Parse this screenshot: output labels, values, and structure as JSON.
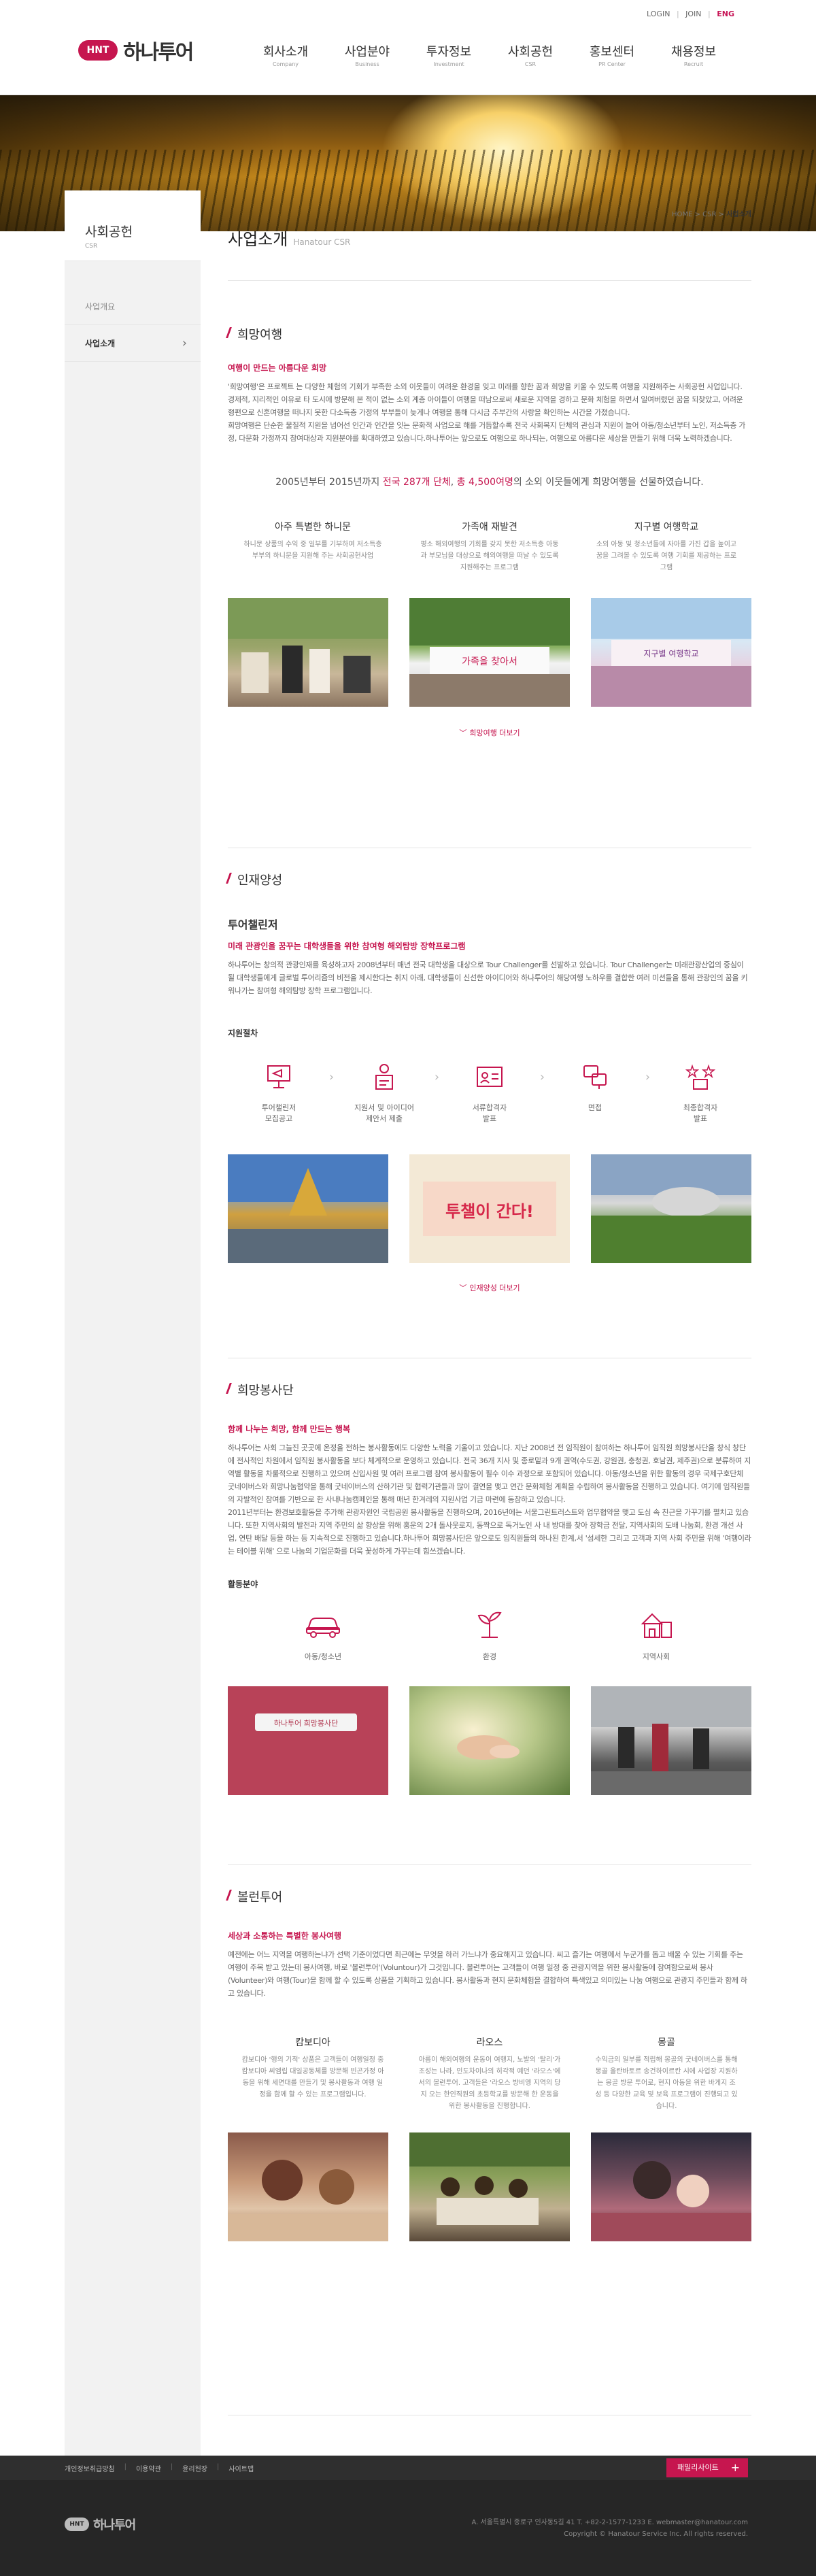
{
  "util": {
    "login": "LOGIN",
    "join": "JOIN",
    "lang_ko": "|",
    "lang_en": "ENG"
  },
  "brand": {
    "mark": "HNT",
    "name": "하나투어"
  },
  "gnb": [
    {
      "ko": "회사소개",
      "en": "Company"
    },
    {
      "ko": "사업분야",
      "en": "Business"
    },
    {
      "ko": "투자정보",
      "en": "Investment"
    },
    {
      "ko": "사회공헌",
      "en": "CSR"
    },
    {
      "ko": "홍보센터",
      "en": "PR Center"
    },
    {
      "ko": "채용정보",
      "en": "Recruit"
    }
  ],
  "sidebar": {
    "title": "사회공헌",
    "subtitle": "CSR",
    "items": [
      {
        "label": "사업개요"
      },
      {
        "label": "사업소개"
      }
    ]
  },
  "breadcrumb": {
    "home": "HOME",
    "sep": ">",
    "csr": "CSR",
    "current": "사업소개"
  },
  "page": {
    "title": "사업소개",
    "subtitle": "Hanatour CSR"
  },
  "hope_travel": {
    "title": "희망여행",
    "lead": "여행이 만드는 아름다운 희망",
    "para1": "'희망여행'은 프로젝트 는 다양한 체험의 기회가 부족한 소외 이웃들이 여려운 환경을 잊고 미래를 향한 꿈과 희망을 키울 수 있도록 여행을 지원해주는 사회공헌 사업입니다.",
    "para2": "경제적, 지리적인 이유로 타 도시에 방문해 본 적이 없는 소외 계층 아이들이 여행을 떠남으로써 새로운 지역을 경하고 문화 체험을 하면서 일여버렸던 꿈을 되찾았고, 어려운 형편으로 신혼여행을 떠나지 못한 다소득층 가정의 부부들이 늦게나 여행을 통해 다시금 추부간의 사랑을 확인하는 시간을 가졌습니다.",
    "para3": "희망여행은 단순한 물질적 지원을 넘어선 인간과 인간을 잇는 문화적 사업으로 해를 거듭할수록 전국 사회복지 단체의 관심과 지원이 늘어 아동/청소년부터 노인, 저소득층 가정, 다문화 가정까지 참여대상과 지원분야를 확대하였고 있습니다.하나투어는 앞으로도 여행으로 하나되는, 여행으로 아름다운 세상을 만들기 위해 더욱 노력하겠습니다.",
    "stat_pre": "2005년부터 2015년까지",
    "stat_hl1": "전국 287개 단체",
    "stat_mid": ",",
    "stat_hl2": "총 4,500여명",
    "stat_post": "의 소외 이웃들에게 희망여행을 선물하였습니다.",
    "columns": [
      {
        "title": "아주 특별한 하니문",
        "desc": "하니문 상품의 수익 중 일부를 기부하여 저소득층 부부의 하니문을 지원해 주는 사회공헌사업"
      },
      {
        "title": "가족애 재발견",
        "desc": "평소 해외여행의 기회를 갖지 못한 저소득층 아동과 부모님을 대상으로 해외여행을 떠날 수 있도록 지원해주는 프로그램"
      },
      {
        "title": "지구별 여행학교",
        "desc": "소외 아동 및 청소년들에 자아를 가진 갑을 높이고 꿈을 그려볼 수 있도록 여행 기회를 제공하는 프로그램"
      }
    ],
    "photo_text": [
      "가족을 찾아서",
      "지구별 여행학교"
    ],
    "more": "희망여행 더보기"
  },
  "talent": {
    "title": "인재양성",
    "sub": "투어챌린저",
    "lead": "미래 관광인을 꿈꾸는 대학생들을 위한 참여형 해외탐방 장학프로그램",
    "para": "하나투어는 창의적 관광인재를 육성하고자 2008년부터 매년 전국 대학생을 대상으로 Tour Challenger를 선발하고 있습니다. Tour Challenger는 미래관광산업의 중심이 될 대학생들에게 글로벌 투어리즘의 비전을 제시한다는 취지 아래, 대학생들이 신선한 아이디어와 하나투어의 해당여행 노하우를 결합한 여러 미션들을 통해 관광인의 꿈을 키워나가는 참여형 해외탐방 장학 프로그램입니다.",
    "process_title": "지원절차",
    "steps": [
      {
        "label": "투어챌린저\n모집공고"
      },
      {
        "label": "지원서 및 아이디어\n제안서 제출"
      },
      {
        "label": "서류합격자\n발표"
      },
      {
        "label": "면접"
      },
      {
        "label": "최종합격자\n발표"
      }
    ],
    "arrow": "›",
    "photo_text": "투챌이 간다!",
    "more": "인재양성 더보기"
  },
  "volunteer": {
    "title": "희망봉사단",
    "lead": "함께 나누는 희망, 함께 만드는 행복",
    "para1": "하나투어는 사회 그늘진 곳곳에 온정을 전하는 봉사활동에도 다양한 노력을 기울이고 있습니다. 지난 2008년 전 임직원이 참여하는 하나투어 임직원 희망봉사단을 창식 창단에 전사적인 차원에서 임직원 봉사활동을 보다 체계적으로 운영하고 있습니다. 전국 36개 지사 및 종로밑과 9개 권역(수도권, 강원권, 충청권, 호남권, 제주권)으로 분류하여 지역별 활동을 차룰적으로 진행하고 있으며 신입사원 및 여러 프로그램 참여 봉사활동이 필수 이수 과정으로 포함되어 있습니다. 아동/청소년을 위한 활동의 경우 국제구호단체 굿네이버스와 희망나눔협약을 통해 굿네이버스의 산하기관 및 협력기관들과 많이 결연을 맺고 연간 문화체험 계획을 수립하여 봉사활동을 진행하고 있습니다. 여기에 임직원들의 자발적인 참여를 기반으로 한 사내나눔캠페인을 통해 매년 한겨레의 지원사업 기금 마련에 동참하고 있습니다.",
    "para2": "2011년부터는 환경보호활동을 추가해 관광자원인 국립공원 봉사활동을 진행하으며, 2016년에는 서울그린트러스트와 업무협약을 맺고 도심 속 친근을 가꾸기를 펼치고 있습니다. 또한 지역사회의 발전과 지역 주민의 삶 향상을 위해 홍운의 2개 돌사웃로지, 동짝으로 독거노인 사 내 방대를 찾아 장학금 전달, 지역사회의 도배 나눔회, 환경 개선 사업, 연탄 배달 등을 하는 등 지속적으로 진행하고 있습니다.하나투어 희망봉사단은 앞으로도 임직원들의 하나된 한계,서 '섬세한 그리고 고객과 지역 사회 주민을 위해 '여행이라는 테이블 위해' 으로 나눔의 기업문화를 더욱 꽃성하게 가꾸는데 힘쓰겠습니다.",
    "area_title": "활동분야",
    "areas": [
      {
        "label": "아동/청소년"
      },
      {
        "label": "환경"
      },
      {
        "label": "지역사회"
      }
    ],
    "photo_text": "하나투어 희망봉사단"
  },
  "voluntour": {
    "title": "볼런투어",
    "lead": "세상과 소통하는 특별한 봉사여행",
    "para": "예전에는 어느 지역을 여행하는냐가 선택 기준이었다면 최근에는 무엇을 하러 가느냐가 중요해지고 있습니다. 씨고 즐기는 여행에서 누군가를 돕고 배울 수 있는 기회를 주는 여행이 주목 받고 있는데 봉사여행, 바로 '볼런투어'(Voluntour)가 그것입니다. 볼런투어는 고객들이 여행 일정 중 관광지역을 위한 봉사활동에 참여함으로써 봉사(Volunteer)와 여행(Tour)을 함께 할 수 있도록 상품을 기획하고 있습니다. 봉사활동과 현지 문화체험을 결합하여 특색있고 의미있는 나눔 여행으로 관광지 주민들과 함께 하고 있습니다.",
    "columns": [
      {
        "title": "캄보디아",
        "desc": "캄보디아 '행의 기적' 상품은 고객들이 여행일정 중 캄보디아 씨엠립 대일공동체를 방문해 빈곤가정 아동을 위해 세면대를 만들기 및 봉사활동과 여행 일정을 함께 할 수 있는 프로그램입니다."
      },
      {
        "title": "라오스",
        "desc": "아름이 해외여행의 운동이 여행지, 노발의 '탈리'가 조성는 나라, 인도차이나의 히각적 예던 '라오스'에서의 볼런투어. 고객들은 '라오스 방비엥 지역의 당지 오는 한인직원의 초등학교를 방문해 한 운동을 위한 봉사활동을 진행합니다."
      },
      {
        "title": "몽골",
        "desc": "수익금의 일부를 적립해 몽골의 굿네이버스를 통해 몽골 울란바토르 송건하이르칸 시에 사업장 지원하는 몽골 방문 투어로, 현지 아동을 위한 바게지 조성 등 다양한 교육 및 보육 프로그램이 진행되고 있습니다."
      }
    ]
  },
  "footer": {
    "links": [
      "개인정보취급방침",
      "이용약관",
      "윤리헌장",
      "사이트맵"
    ],
    "sep": "|",
    "familysite": "패밀리사이트",
    "plus": "+",
    "logo_mark": "HNT",
    "logo_name": "하나투어",
    "address": "A. 서울특별시 종로구 인사동5길 41 T. +82-2-1577-1233 E. webmaster@hanatour.com",
    "copyright": "Copyright © Hanatour Service Inc. All rights reserved."
  },
  "colors": {
    "accent": "#c6164f",
    "footer_dark": "#262626",
    "footer_nav": "#2f2f2f",
    "sidebar_bg": "#f2f2f2"
  }
}
